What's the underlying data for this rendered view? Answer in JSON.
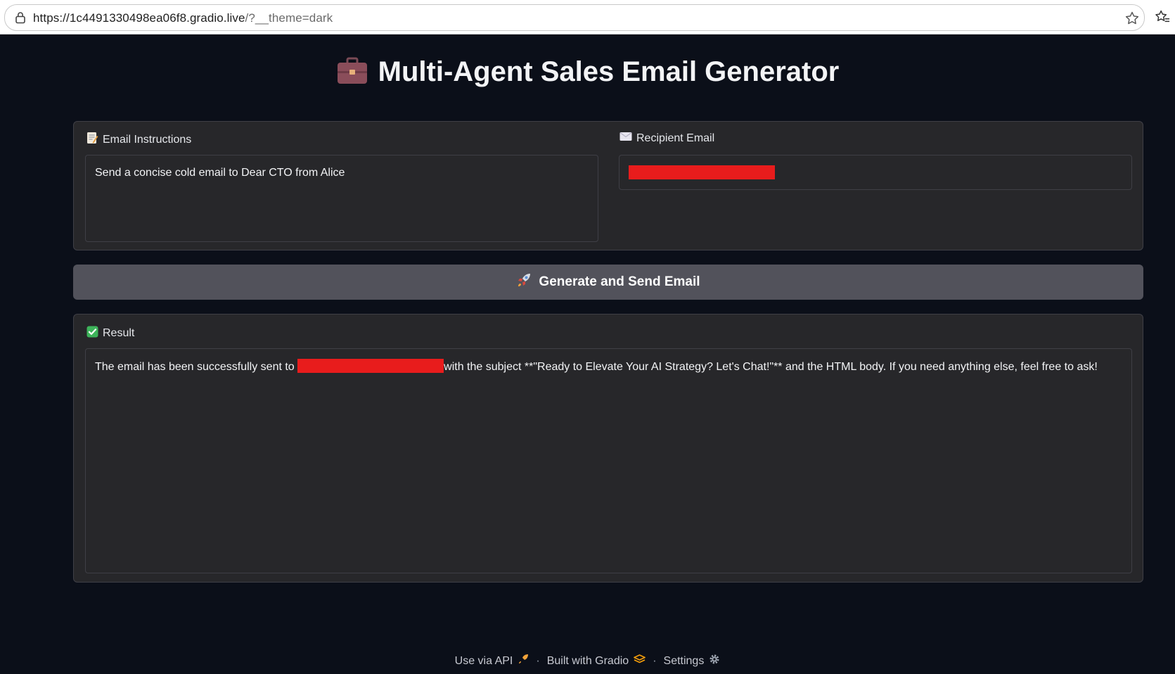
{
  "browser": {
    "url_host": "https://1c4491330498ea06f8.gradio.live",
    "url_rest": "/?__theme=dark",
    "icons": [
      "lock-icon",
      "star-icon",
      "favorites-icon"
    ]
  },
  "header": {
    "emoji_icon": "briefcase-icon",
    "title": "Multi-Agent Sales Email Generator"
  },
  "instructions": {
    "label": "Email Instructions",
    "icon": "memo-icon",
    "value": "Send a concise cold email to Dear CTO from Alice"
  },
  "recipient": {
    "label": "Recipient Email",
    "icon": "envelope-icon"
  },
  "action": {
    "label": "Generate and Send Email",
    "icon": "rocket-icon"
  },
  "result": {
    "label": "Result",
    "icon": "check-icon",
    "text_before": "The email has been successfully sent to ",
    "text_after": "with the subject **\"Ready to Elevate Your AI Strategy? Let's Chat!\"** and the HTML body. If you need anything else, feel free to ask!"
  },
  "footer": {
    "api_label": "Use via API",
    "built_label": "Built with Gradio",
    "settings_label": "Settings",
    "separator": "·"
  },
  "colors": {
    "background": "#0b0f19",
    "panel": "#27272a",
    "button": "#52525b",
    "redaction": "#e81c1c"
  }
}
